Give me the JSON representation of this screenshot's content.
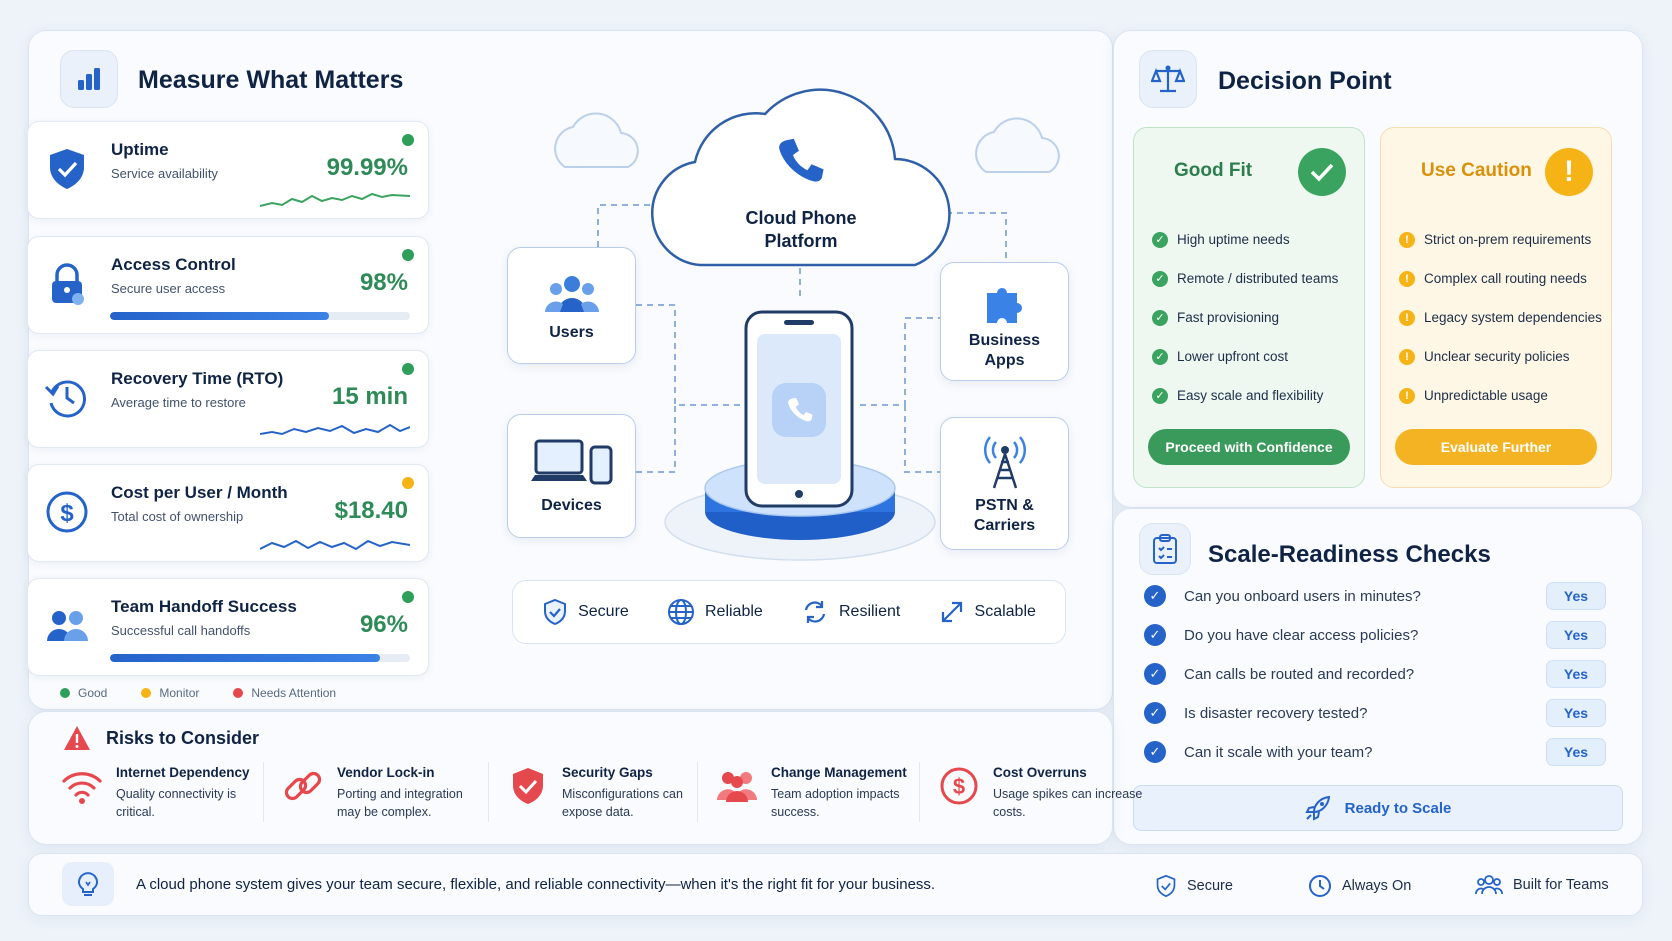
{
  "measure": {
    "title": "Measure What Matters",
    "metrics": [
      {
        "title": "Uptime",
        "subtitle": "Service availability",
        "value": "99.99%",
        "status": "good"
      },
      {
        "title": "Access Control",
        "subtitle": "Secure user access",
        "value": "98%",
        "status": "good",
        "progress": 0.73
      },
      {
        "title": "Recovery Time (RTO)",
        "subtitle": "Average time to restore",
        "value": "15 min",
        "status": "good"
      },
      {
        "title": "Cost per User / Month",
        "subtitle": "Total cost of ownership",
        "value": "$18.40",
        "status": "monitor"
      },
      {
        "title": "Team Handoff Success",
        "subtitle": "Successful call handoffs",
        "value": "96%",
        "status": "good",
        "progress": 0.9
      }
    ],
    "legend": {
      "good": "Good",
      "monitor": "Monitor",
      "attention": "Needs Attention"
    },
    "colors": {
      "good": "#2e9e5b",
      "monitor": "#f5b316",
      "attention": "#e5484d",
      "value": "#2e8b57",
      "accent": "#2563c9"
    }
  },
  "diagram": {
    "center": "Cloud Phone Platform",
    "nodes": {
      "users": "Users",
      "devices": "Devices",
      "business_apps": "Business Apps",
      "pstn": "PSTN & Carriers"
    },
    "pillars": [
      "Secure",
      "Reliable",
      "Resilient",
      "Scalable"
    ]
  },
  "decision": {
    "title": "Decision Point",
    "good_fit": {
      "title": "Good Fit",
      "items": [
        "High uptime needs",
        "Remote / distributed teams",
        "Fast provisioning",
        "Lower upfront cost",
        "Easy scale and flexibility"
      ],
      "button": "Proceed with Confidence"
    },
    "caution": {
      "title": "Use Caution",
      "items": [
        "Strict on-prem requirements",
        "Complex call routing needs",
        "Legacy system dependencies",
        "Unclear security policies",
        "Unpredictable usage"
      ],
      "button": "Evaluate Further"
    }
  },
  "scale": {
    "title": "Scale-Readiness Checks",
    "checks": [
      {
        "question": "Can you onboard users in minutes?",
        "answer": "Yes"
      },
      {
        "question": "Do you have clear access policies?",
        "answer": "Yes"
      },
      {
        "question": "Can calls be routed and recorded?",
        "answer": "Yes"
      },
      {
        "question": "Is disaster recovery tested?",
        "answer": "Yes"
      },
      {
        "question": "Can it scale with your team?",
        "answer": "Yes"
      }
    ],
    "button": "Ready to Scale"
  },
  "risks": {
    "title": "Risks to Consider",
    "items": [
      {
        "title": "Internet Dependency",
        "desc": "Quality connectivity is critical.",
        "icon": "wifi-icon"
      },
      {
        "title": "Vendor Lock-in",
        "desc": "Porting and integration may be complex.",
        "icon": "link-icon"
      },
      {
        "title": "Security Gaps",
        "desc": "Misconfigurations can expose data.",
        "icon": "shield-icon"
      },
      {
        "title": "Change Management",
        "desc": "Team adoption impacts success.",
        "icon": "people-icon"
      },
      {
        "title": "Cost Overruns",
        "desc": "Usage spikes can increase costs.",
        "icon": "dollar-icon"
      }
    ]
  },
  "footer": {
    "message": "A cloud phone system gives your team secure, flexible, and reliable connectivity—when it's the right fit for your business.",
    "tags": [
      "Secure",
      "Always On",
      "Built for Teams"
    ]
  }
}
